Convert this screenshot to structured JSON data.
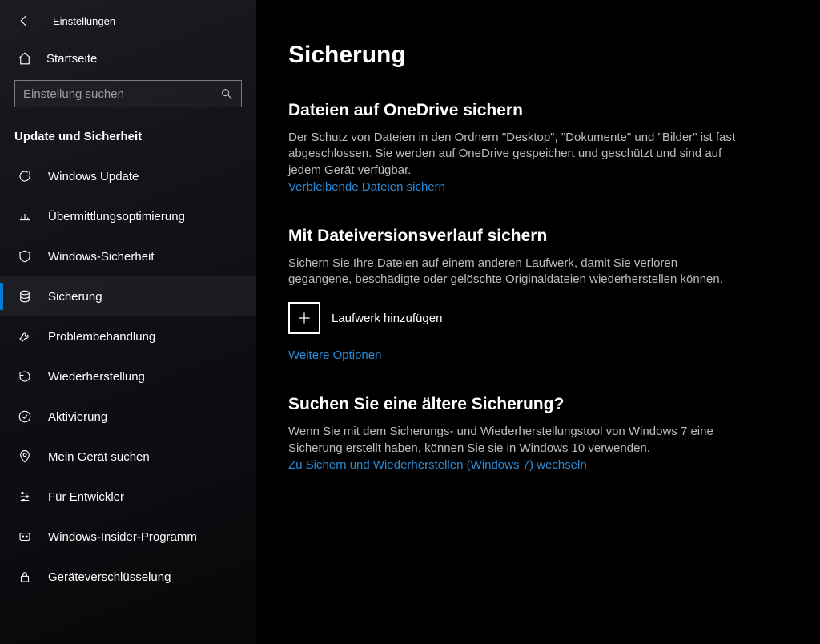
{
  "app_title": "Einstellungen",
  "home_label": "Startseite",
  "search_placeholder": "Einstellung suchen",
  "section_label": "Update und Sicherheit",
  "sidebar": {
    "items": [
      {
        "label": "Windows Update"
      },
      {
        "label": "Übermittlungsoptimierung"
      },
      {
        "label": "Windows-Sicherheit"
      },
      {
        "label": "Sicherung"
      },
      {
        "label": "Problembehandlung"
      },
      {
        "label": "Wiederherstellung"
      },
      {
        "label": "Aktivierung"
      },
      {
        "label": "Mein Gerät suchen"
      },
      {
        "label": "Für Entwickler"
      },
      {
        "label": "Windows-Insider-Programm"
      },
      {
        "label": "Geräteverschlüsselung"
      }
    ]
  },
  "main": {
    "title": "Sicherung",
    "onedrive": {
      "heading": "Dateien auf OneDrive sichern",
      "body": "Der Schutz von Dateien in den Ordnern \"Desktop\", \"Dokumente\" und \"Bilder\" ist fast abgeschlossen. Sie werden auf OneDrive gespeichert und geschützt und sind auf jedem Gerät verfügbar.",
      "link": "Verbleibende Dateien sichern"
    },
    "filehistory": {
      "heading": "Mit Dateiversionsverlauf sichern",
      "body": "Sichern Sie Ihre Dateien auf einem anderen Laufwerk, damit Sie verloren gegangene, beschädigte oder gelöschte Originaldateien wiederherstellen können.",
      "add_label": "Laufwerk hinzufügen",
      "more_link": "Weitere Optionen"
    },
    "legacy": {
      "heading": "Suchen Sie eine ältere Sicherung?",
      "body": "Wenn Sie mit dem Sicherungs- und Wiederherstellungstool von Windows 7 eine Sicherung erstellt haben, können Sie sie in Windows 10 verwenden.",
      "link": "Zu Sichern und Wiederherstellen (Windows 7) wechseln"
    }
  }
}
